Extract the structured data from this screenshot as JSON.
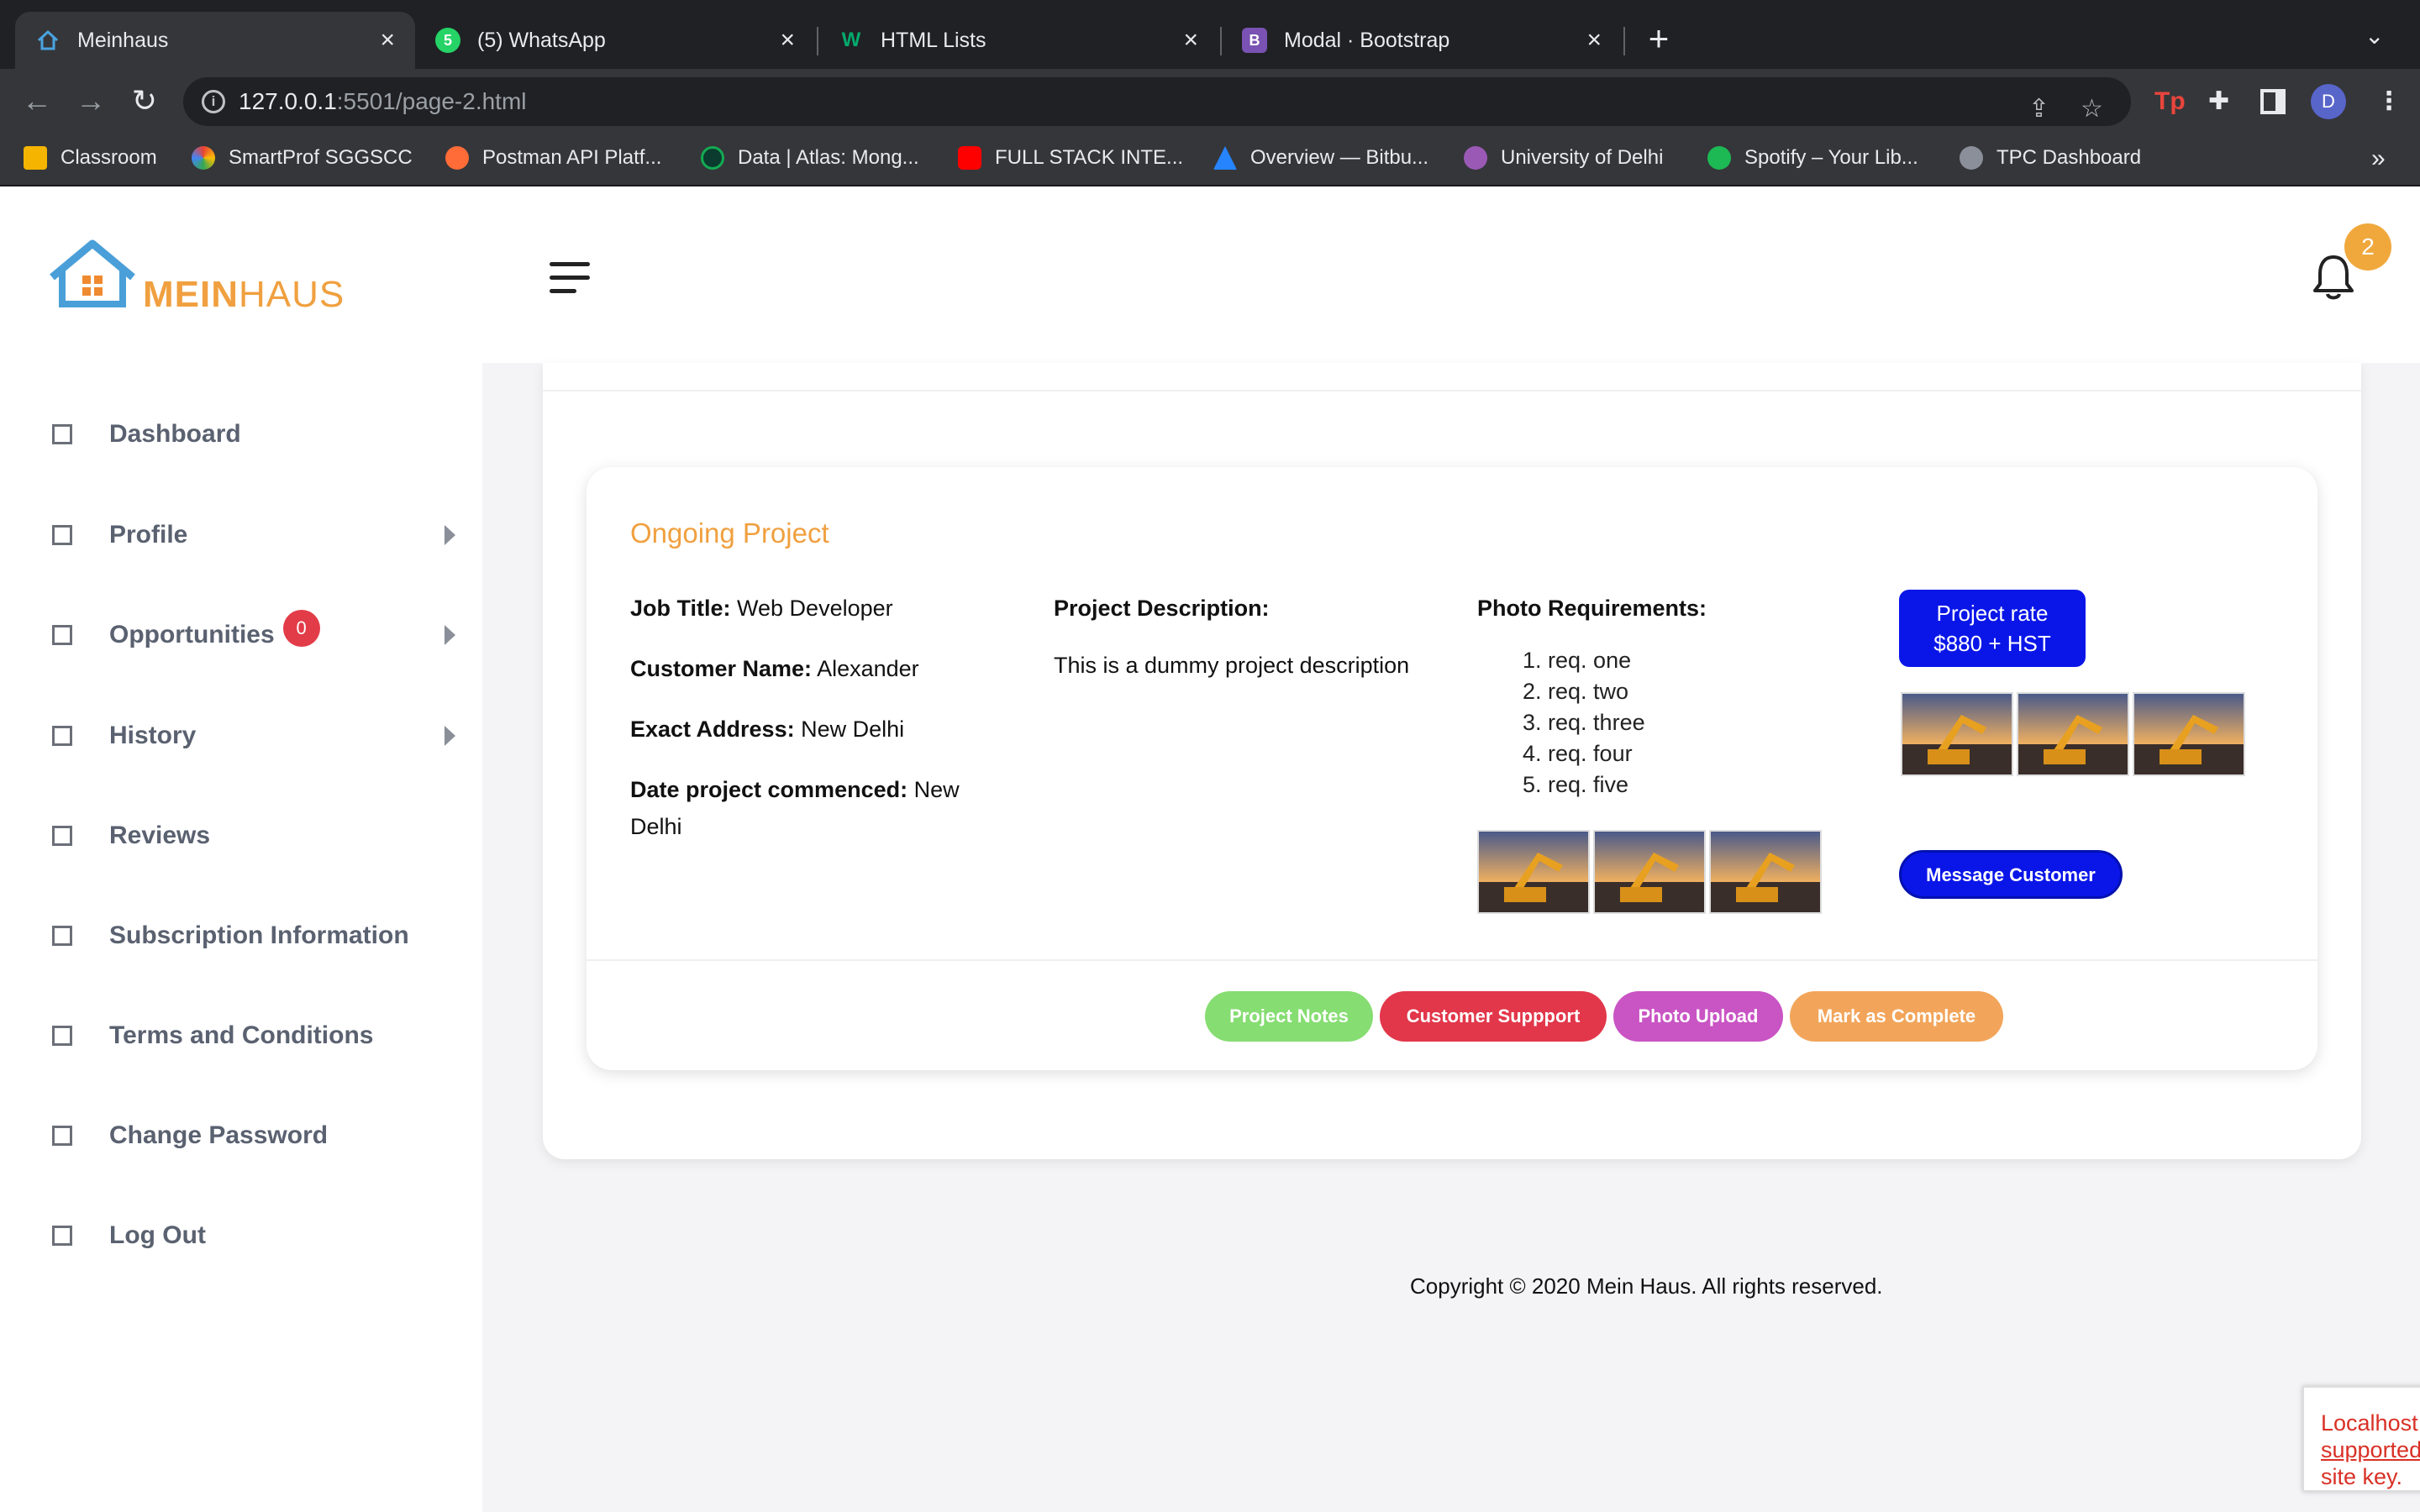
{
  "browser": {
    "tabs": [
      {
        "title": "Meinhaus",
        "active": true,
        "icon": "house-icon"
      },
      {
        "title": "(5) WhatsApp",
        "active": false,
        "icon": "whatsapp-icon"
      },
      {
        "title": "HTML Lists",
        "active": false,
        "icon": "w3schools-icon"
      },
      {
        "title": "Modal · Bootstrap",
        "active": false,
        "icon": "bootstrap-icon"
      }
    ],
    "url_host": "127.0.0.1",
    "url_rest": ":5501/page-2.html",
    "profile_initial": "D",
    "extension_label": "Tp",
    "bookmarks": [
      {
        "label": "Classroom",
        "color": "#f4b400"
      },
      {
        "label": "SmartProf SGGSCC",
        "color": "#e94235"
      },
      {
        "label": "Postman API Platf...",
        "color": "#ff6c37"
      },
      {
        "label": "Data | Atlas: Mong...",
        "color": "#13aa52"
      },
      {
        "label": "FULL STACK INTE...",
        "color": "#ff0000"
      },
      {
        "label": "Overview — Bitbu...",
        "color": "#2684ff"
      },
      {
        "label": "University of Delhi",
        "color": "#9b59b6"
      },
      {
        "label": "Spotify – Your Lib...",
        "color": "#1db954"
      },
      {
        "label": "TPC Dashboard",
        "color": "#8a8f99"
      }
    ],
    "more_bookmarks": "»"
  },
  "header": {
    "logo_bold": "MEIN",
    "logo_rest": "HAUS",
    "notification_count": "2"
  },
  "sidebar": {
    "items": [
      {
        "label": "Dashboard",
        "caret": false
      },
      {
        "label": "Profile",
        "caret": true
      },
      {
        "label": "Opportunities",
        "caret": true,
        "badge": "0"
      },
      {
        "label": "History",
        "caret": true
      },
      {
        "label": "Reviews",
        "caret": false
      },
      {
        "label": "Subscription Information",
        "caret": false
      },
      {
        "label": "Terms and Conditions",
        "caret": false
      },
      {
        "label": "Change Password",
        "caret": false
      },
      {
        "label": "Log Out",
        "caret": false
      }
    ]
  },
  "project": {
    "title": "Ongoing Project",
    "job_title_label": "Job Title:",
    "job_title": "Web Developer",
    "customer_name_label": "Customer Name:",
    "customer_name": "Alexander",
    "address_label": "Exact Address:",
    "address": "New Delhi",
    "date_label": "Date project commenced:",
    "date": "New Delhi",
    "description_label": "Project Description:",
    "description": "This is a dummy project description",
    "photo_req_label": "Photo Requirements:",
    "requirements": [
      "req. one",
      "req. two",
      "req. three",
      "req. four",
      "req. five"
    ],
    "rate_line1": "Project rate",
    "rate_line2": "$880 + HST",
    "message_button": "Message Customer",
    "actions": [
      {
        "label": "Project Notes",
        "color": "#86dd72"
      },
      {
        "label": "Customer Suppport",
        "color": "#e2374a"
      },
      {
        "label": "Photo Upload",
        "color": "#c954c4"
      },
      {
        "label": "Mark as Complete",
        "color": "#f2a55a"
      }
    ]
  },
  "footer": {
    "copyright": "Copyright © 2020 Mein Haus. All rights reserved."
  },
  "recaptcha": {
    "line1": "Localhost",
    "line2": "supported",
    "line3": "site key."
  },
  "colors": {
    "accent": "#f0a040",
    "primary_button": "#0a16e8"
  }
}
